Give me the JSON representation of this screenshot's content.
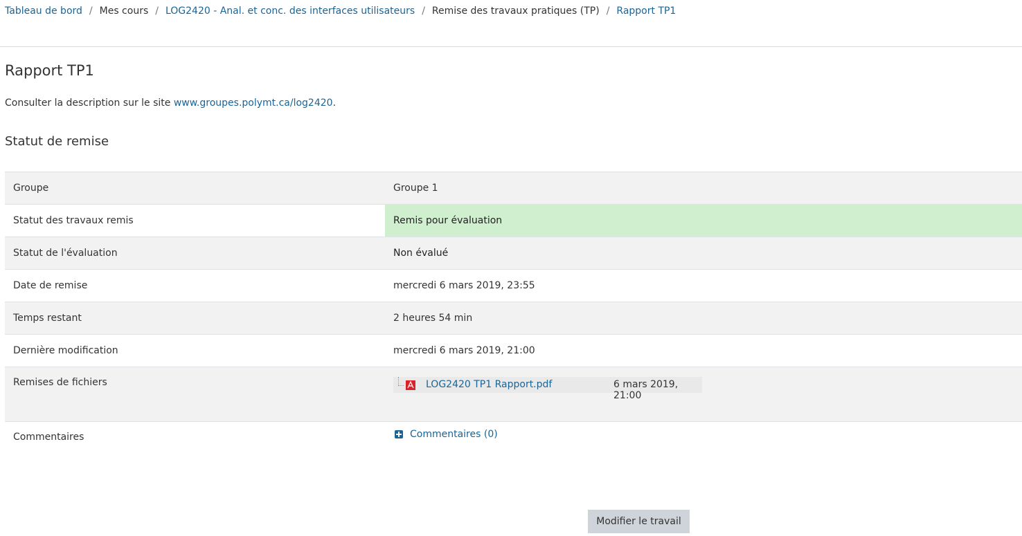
{
  "breadcrumb": {
    "items": [
      {
        "label": "Tableau de bord",
        "link": true
      },
      {
        "label": "Mes cours",
        "link": false
      },
      {
        "label": "LOG2420 - Anal. et conc. des interfaces utilisateurs",
        "link": true
      },
      {
        "label": "Remise des travaux pratiques (TP)",
        "link": false
      },
      {
        "label": "Rapport TP1",
        "link": true
      }
    ],
    "separator": "/"
  },
  "page": {
    "title": "Rapport TP1",
    "intro_text": "Consulter la description sur le site ",
    "intro_link": "www.groupes.polymt.ca/log2420",
    "intro_end": "."
  },
  "status": {
    "heading": "Statut de remise",
    "rows": {
      "group": {
        "label": "Groupe",
        "value": "Groupe 1"
      },
      "submission": {
        "label": "Statut des travaux remis",
        "value": "Remis pour évaluation"
      },
      "grading": {
        "label": "Statut de l'évaluation",
        "value": "Non évalué"
      },
      "due": {
        "label": "Date de remise",
        "value": "mercredi 6 mars 2019, 23:55"
      },
      "remaining": {
        "label": "Temps restant",
        "value": "2 heures 54 min"
      },
      "modified": {
        "label": "Dernière modification",
        "value": "mercredi 6 mars 2019, 21:00"
      },
      "files": {
        "label": "Remises de fichiers",
        "file_name": "LOG2420 TP1 Rapport.pdf",
        "file_date": "6 mars 2019, 21:00"
      },
      "comments": {
        "label": "Commentaires",
        "link": "Commentaires (0)"
      }
    }
  },
  "actions": {
    "edit_button": "Modifier le travail"
  },
  "colors": {
    "link": "#1a6496",
    "submitted_bg": "#cfefcf",
    "stripe_bg": "#f2f2f2",
    "button_bg": "#ced4da",
    "pdf_red": "#d9232a"
  }
}
